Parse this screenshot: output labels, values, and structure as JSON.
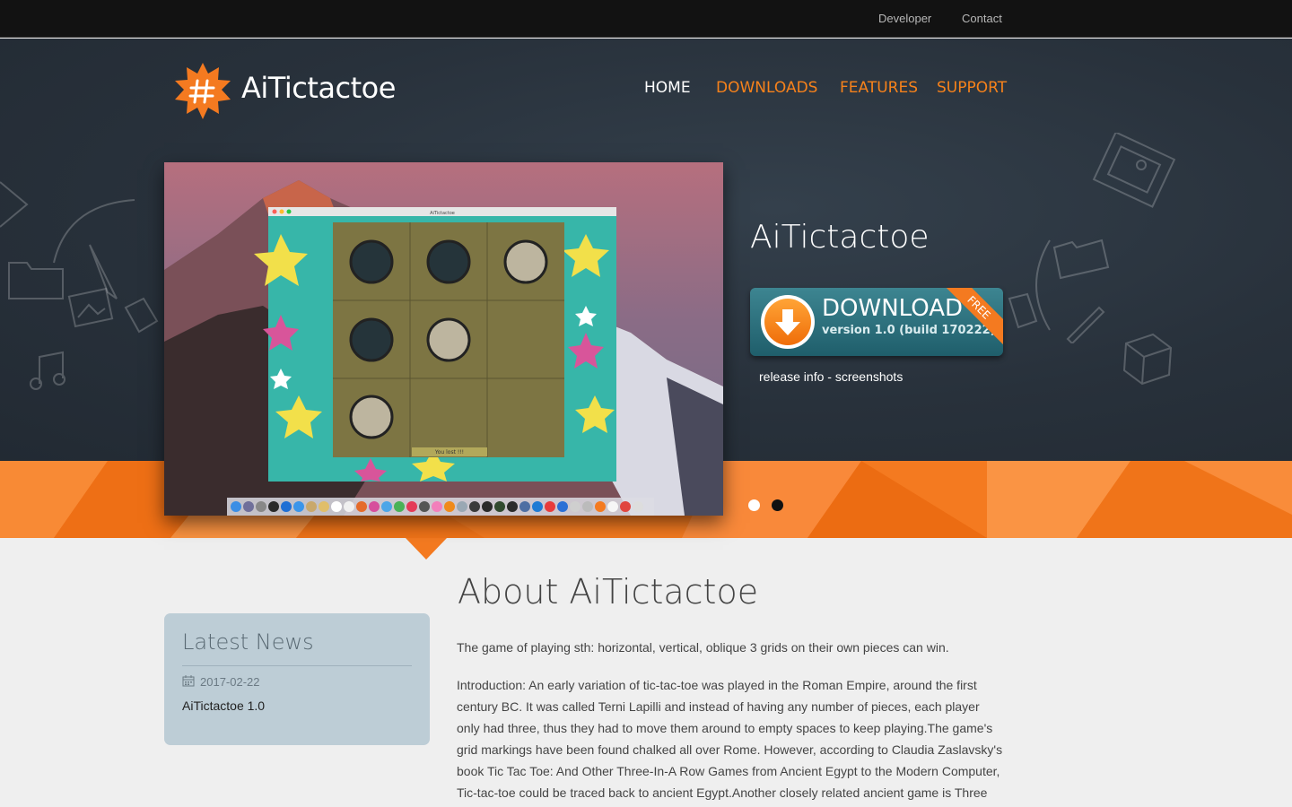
{
  "topbar": {
    "developer": "Developer",
    "contact": "Contact"
  },
  "brand": {
    "name": "AiTictactoe",
    "logo_icon": "hash-sun-icon"
  },
  "nav": {
    "home": "HOME",
    "downloads": "DOWNLOADS",
    "features": "FEATURES",
    "support": "SUPPORT"
  },
  "hero": {
    "title": "AiTictactoe",
    "download_label": "DOWNLOAD",
    "download_version": "version 1.0 (build 170222)",
    "ribbon": "FREE",
    "release_info": "release info",
    "separator": " - ",
    "screenshots": "screenshots"
  },
  "shot": {
    "window_title": "AiTictactoe",
    "status": "You lost !!!"
  },
  "about": {
    "title": "About AiTictactoe",
    "p1": "The game of playing sth: horizontal, vertical, oblique 3 grids on their own pieces can win.",
    "p2_lines": [
      "Introduction: An early variation of tic-tac-toe was played in the Roman Empire, around the first",
      "century BC. It was called Terni Lapilli and instead of having any number of pieces, each player",
      "only had three, thus they had to move them around to empty spaces to keep playing.The game's",
      "grid markings have been found chalked all over Rome. However, according to Claudia Zaslavsky's",
      "book Tic Tac Toe: And Other Three-In-A Row Games from Ancient Egypt to the Modern Computer,",
      "Tic-tac-toe could be traced back to ancient Egypt.Another closely related ancient game is Three"
    ]
  },
  "news": {
    "title": "Latest News",
    "date": "2017-02-22",
    "item": "AiTictactoe 1.0"
  },
  "colors": {
    "accent": "#f47a20",
    "hero_bg": "#28313b",
    "topbar_bg": "#121212"
  }
}
